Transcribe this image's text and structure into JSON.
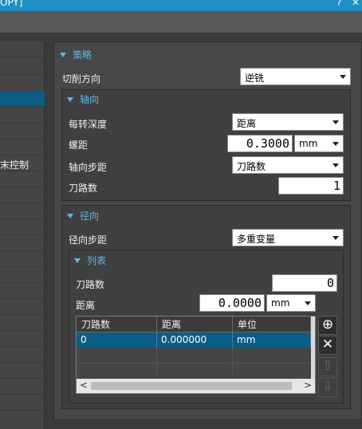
{
  "window": {
    "title_fragment": "OPY]",
    "help_glyph": "?",
    "close_glyph": "✕"
  },
  "left_panel": {
    "items": [
      {
        "label": ""
      },
      {
        "label": ""
      },
      {
        "label": "",
        "selected": true
      },
      {
        "label": ""
      },
      {
        "label": ""
      },
      {
        "label": ""
      },
      {
        "label": "末控制"
      }
    ]
  },
  "strategy": {
    "header": "策略",
    "cut_direction": {
      "label": "切削方向",
      "value": "逆铣"
    },
    "axial": {
      "header": "轴向",
      "depth_per_rev": {
        "label": "每转深度",
        "value": "距离"
      },
      "pitch": {
        "label": "螺距",
        "value": "0.3000",
        "unit": "mm"
      },
      "axial_step": {
        "label": "轴向步距",
        "value": "刀路数"
      },
      "pass_count": {
        "label": "刀路数",
        "value": "1"
      }
    },
    "radial": {
      "header": "径向",
      "radial_step": {
        "label": "径向步距",
        "value": "多重变量"
      },
      "list": {
        "header": "列表",
        "pass_count": {
          "label": "刀路数",
          "value": "0"
        },
        "distance": {
          "label": "距离",
          "value": "0.0000",
          "unit": "mm"
        },
        "table": {
          "columns": [
            "刀路数",
            "距离",
            "单位"
          ],
          "rows": [
            [
              "0",
              "0.000000",
              "mm"
            ]
          ]
        },
        "buttons": {
          "add": "⊕",
          "delete": "✕",
          "up": "⇧",
          "down": "⇩"
        },
        "scroll": {
          "left": "<",
          "right": ">"
        }
      }
    }
  }
}
